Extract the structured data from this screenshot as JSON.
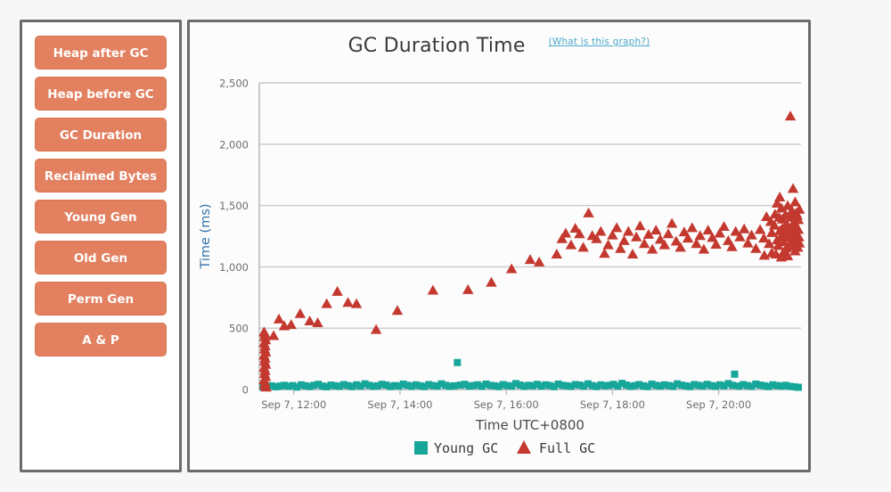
{
  "sidebar": {
    "items": [
      {
        "label": "Heap after GC"
      },
      {
        "label": "Heap before GC"
      },
      {
        "label": "GC Duration"
      },
      {
        "label": "Reclaimed Bytes"
      },
      {
        "label": "Young Gen"
      },
      {
        "label": "Old Gen"
      },
      {
        "label": "Perm Gen"
      },
      {
        "label": "A & P"
      }
    ]
  },
  "chart_panel": {
    "title": "GC Duration Time",
    "help_link": "(What is this graph?)"
  },
  "colors": {
    "button": "#e28060",
    "button_border": "#d9744f",
    "panel_border": "#6b6b6b",
    "young_gc": "#17a79a",
    "full_gc": "#c4392f",
    "grid": "#c9c9c9",
    "axis_title_y": "#2f6fa8",
    "link": "#4aa8c9"
  },
  "chart_data": {
    "type": "scatter",
    "title": "GC Duration Time",
    "xlabel": "Time UTC+0800",
    "ylabel": "Time (ms)",
    "ylim": [
      0,
      2500
    ],
    "yticks": [
      0,
      500,
      1000,
      1500,
      2000,
      2500
    ],
    "ytick_labels": [
      "0",
      "500",
      "1,000",
      "1,500",
      "2,000",
      "2,500"
    ],
    "xlim": [
      11.35,
      21.55
    ],
    "xticks": [
      12,
      14,
      16,
      18,
      20
    ],
    "xtick_labels": [
      "Sep 7, 12:00",
      "Sep 7, 14:00",
      "Sep 7, 16:00",
      "Sep 7, 18:00",
      "Sep 7, 20:00"
    ],
    "grid": true,
    "legend_position": "bottom",
    "series": [
      {
        "name": "Young GC",
        "marker": "square",
        "color": "#17a79a",
        "points": [
          [
            11.42,
            18
          ],
          [
            11.5,
            24
          ],
          [
            11.58,
            30
          ],
          [
            11.66,
            22
          ],
          [
            11.74,
            28
          ],
          [
            11.82,
            34
          ],
          [
            11.9,
            26
          ],
          [
            11.98,
            32
          ],
          [
            12.06,
            20
          ],
          [
            12.14,
            38
          ],
          [
            12.22,
            30
          ],
          [
            12.3,
            24
          ],
          [
            12.38,
            34
          ],
          [
            12.46,
            42
          ],
          [
            12.54,
            28
          ],
          [
            12.62,
            22
          ],
          [
            12.7,
            36
          ],
          [
            12.78,
            30
          ],
          [
            12.86,
            26
          ],
          [
            12.94,
            40
          ],
          [
            13.02,
            32
          ],
          [
            13.1,
            24
          ],
          [
            13.18,
            38
          ],
          [
            13.26,
            28
          ],
          [
            13.34,
            46
          ],
          [
            13.42,
            34
          ],
          [
            13.5,
            26
          ],
          [
            13.58,
            30
          ],
          [
            13.66,
            42
          ],
          [
            13.74,
            36
          ],
          [
            13.82,
            24
          ],
          [
            13.9,
            32
          ],
          [
            13.98,
            28
          ],
          [
            14.06,
            44
          ],
          [
            14.14,
            34
          ],
          [
            14.22,
            26
          ],
          [
            14.3,
            38
          ],
          [
            14.38,
            30
          ],
          [
            14.46,
            24
          ],
          [
            14.54,
            40
          ],
          [
            14.62,
            32
          ],
          [
            14.7,
            28
          ],
          [
            14.78,
            46
          ],
          [
            14.86,
            34
          ],
          [
            14.94,
            26
          ],
          [
            15.02,
            30
          ],
          [
            15.08,
            220
          ],
          [
            15.14,
            36
          ],
          [
            15.22,
            42
          ],
          [
            15.3,
            28
          ],
          [
            15.38,
            32
          ],
          [
            15.46,
            38
          ],
          [
            15.54,
            26
          ],
          [
            15.62,
            44
          ],
          [
            15.7,
            34
          ],
          [
            15.78,
            30
          ],
          [
            15.86,
            24
          ],
          [
            15.94,
            40
          ],
          [
            16.02,
            32
          ],
          [
            16.1,
            28
          ],
          [
            16.18,
            48
          ],
          [
            16.26,
            36
          ],
          [
            16.34,
            26
          ],
          [
            16.42,
            34
          ],
          [
            16.5,
            30
          ],
          [
            16.58,
            42
          ],
          [
            16.66,
            28
          ],
          [
            16.74,
            38
          ],
          [
            16.82,
            32
          ],
          [
            16.9,
            24
          ],
          [
            16.98,
            44
          ],
          [
            17.06,
            34
          ],
          [
            17.14,
            30
          ],
          [
            17.22,
            26
          ],
          [
            17.3,
            40
          ],
          [
            17.38,
            36
          ],
          [
            17.46,
            28
          ],
          [
            17.54,
            46
          ],
          [
            17.62,
            32
          ],
          [
            17.7,
            24
          ],
          [
            17.78,
            38
          ],
          [
            17.86,
            30
          ],
          [
            17.94,
            34
          ],
          [
            18.02,
            42
          ],
          [
            18.1,
            28
          ],
          [
            18.18,
            50
          ],
          [
            18.26,
            36
          ],
          [
            18.34,
            26
          ],
          [
            18.42,
            32
          ],
          [
            18.5,
            40
          ],
          [
            18.58,
            30
          ],
          [
            18.66,
            24
          ],
          [
            18.74,
            44
          ],
          [
            18.82,
            34
          ],
          [
            18.9,
            28
          ],
          [
            18.98,
            38
          ],
          [
            19.06,
            32
          ],
          [
            19.14,
            26
          ],
          [
            19.22,
            46
          ],
          [
            19.3,
            36
          ],
          [
            19.38,
            30
          ],
          [
            19.46,
            24
          ],
          [
            19.54,
            40
          ],
          [
            19.62,
            34
          ],
          [
            19.7,
            28
          ],
          [
            19.78,
            42
          ],
          [
            19.86,
            32
          ],
          [
            19.94,
            26
          ],
          [
            20.02,
            38
          ],
          [
            20.1,
            30
          ],
          [
            20.18,
            48
          ],
          [
            20.26,
            34
          ],
          [
            20.3,
            125
          ],
          [
            20.38,
            28
          ],
          [
            20.46,
            40
          ],
          [
            20.54,
            32
          ],
          [
            20.62,
            26
          ],
          [
            20.7,
            44
          ],
          [
            20.78,
            36
          ],
          [
            20.86,
            30
          ],
          [
            20.94,
            24
          ],
          [
            21.02,
            38
          ],
          [
            21.1,
            32
          ],
          [
            21.18,
            28
          ],
          [
            21.26,
            34
          ],
          [
            21.34,
            26
          ],
          [
            21.42,
            22
          ],
          [
            21.5,
            18
          ]
        ]
      },
      {
        "name": "Full GC",
        "marker": "triangle",
        "color": "#c4392f",
        "points": [
          [
            11.44,
            470
          ],
          [
            11.46,
            455
          ],
          [
            11.45,
            430
          ],
          [
            11.47,
            405
          ],
          [
            11.44,
            380
          ],
          [
            11.46,
            355
          ],
          [
            11.45,
            330
          ],
          [
            11.47,
            305
          ],
          [
            11.44,
            280
          ],
          [
            11.46,
            255
          ],
          [
            11.45,
            230
          ],
          [
            11.47,
            205
          ],
          [
            11.44,
            180
          ],
          [
            11.46,
            155
          ],
          [
            11.45,
            130
          ],
          [
            11.47,
            105
          ],
          [
            11.44,
            80
          ],
          [
            11.46,
            55
          ],
          [
            11.45,
            35
          ],
          [
            11.48,
            20
          ],
          [
            11.62,
            440
          ],
          [
            11.72,
            575
          ],
          [
            11.82,
            520
          ],
          [
            11.95,
            530
          ],
          [
            12.12,
            620
          ],
          [
            12.3,
            560
          ],
          [
            12.45,
            545
          ],
          [
            12.62,
            700
          ],
          [
            12.82,
            800
          ],
          [
            13.02,
            710
          ],
          [
            13.18,
            700
          ],
          [
            13.55,
            490
          ],
          [
            13.95,
            645
          ],
          [
            14.62,
            810
          ],
          [
            15.28,
            815
          ],
          [
            15.72,
            875
          ],
          [
            16.1,
            985
          ],
          [
            16.45,
            1060
          ],
          [
            16.62,
            1040
          ],
          [
            16.95,
            1105
          ],
          [
            17.05,
            1230
          ],
          [
            17.12,
            1275
          ],
          [
            17.22,
            1180
          ],
          [
            17.3,
            1315
          ],
          [
            17.38,
            1270
          ],
          [
            17.45,
            1160
          ],
          [
            17.55,
            1440
          ],
          [
            17.62,
            1255
          ],
          [
            17.7,
            1230
          ],
          [
            17.78,
            1290
          ],
          [
            17.85,
            1110
          ],
          [
            17.92,
            1180
          ],
          [
            18.0,
            1260
          ],
          [
            18.08,
            1320
          ],
          [
            18.15,
            1150
          ],
          [
            18.22,
            1215
          ],
          [
            18.3,
            1290
          ],
          [
            18.38,
            1105
          ],
          [
            18.45,
            1245
          ],
          [
            18.52,
            1335
          ],
          [
            18.6,
            1190
          ],
          [
            18.68,
            1265
          ],
          [
            18.75,
            1145
          ],
          [
            18.82,
            1300
          ],
          [
            18.9,
            1225
          ],
          [
            18.98,
            1180
          ],
          [
            19.05,
            1270
          ],
          [
            19.12,
            1355
          ],
          [
            19.2,
            1210
          ],
          [
            19.28,
            1160
          ],
          [
            19.35,
            1285
          ],
          [
            19.42,
            1235
          ],
          [
            19.5,
            1320
          ],
          [
            19.58,
            1190
          ],
          [
            19.65,
            1255
          ],
          [
            19.72,
            1145
          ],
          [
            19.8,
            1300
          ],
          [
            19.88,
            1240
          ],
          [
            19.95,
            1185
          ],
          [
            20.02,
            1275
          ],
          [
            20.1,
            1330
          ],
          [
            20.18,
            1215
          ],
          [
            20.25,
            1165
          ],
          [
            20.32,
            1290
          ],
          [
            20.4,
            1245
          ],
          [
            20.48,
            1310
          ],
          [
            20.55,
            1195
          ],
          [
            20.62,
            1260
          ],
          [
            20.7,
            1150
          ],
          [
            20.78,
            1305
          ],
          [
            20.85,
            1235
          ],
          [
            20.9,
            1410
          ],
          [
            20.95,
            1190
          ],
          [
            21.0,
            1280
          ],
          [
            21.05,
            1340
          ],
          [
            21.1,
            1220
          ],
          [
            21.12,
            1175
          ],
          [
            21.15,
            1295
          ],
          [
            21.18,
            1250
          ],
          [
            21.2,
            1315
          ],
          [
            21.22,
            1205
          ],
          [
            21.25,
            1265
          ],
          [
            21.28,
            1155
          ],
          [
            21.3,
            1300
          ],
          [
            21.32,
            1240
          ],
          [
            21.34,
            1190
          ],
          [
            21.36,
            1280
          ],
          [
            21.38,
            1335
          ],
          [
            21.4,
            1215
          ],
          [
            21.42,
            1170
          ],
          [
            21.44,
            1290
          ],
          [
            21.45,
            1250
          ],
          [
            21.46,
            1310
          ],
          [
            21.47,
            1200
          ],
          [
            21.48,
            1265
          ],
          [
            21.49,
            1160
          ],
          [
            21.5,
            1305
          ],
          [
            21.51,
            1245
          ],
          [
            21.52,
            1195
          ],
          [
            21.1,
            1520
          ],
          [
            21.18,
            1480
          ],
          [
            21.26,
            1425
          ],
          [
            21.3,
            1500
          ],
          [
            21.38,
            1460
          ],
          [
            21.44,
            1530
          ],
          [
            21.48,
            1420
          ],
          [
            21.52,
            1470
          ],
          [
            21.2,
            1390
          ],
          [
            21.28,
            1350
          ],
          [
            21.36,
            1405
          ],
          [
            21.42,
            1370
          ],
          [
            21.46,
            1440
          ],
          [
            21.5,
            1385
          ],
          [
            20.98,
            1370
          ],
          [
            21.06,
            1430
          ],
          [
            21.14,
            1405
          ],
          [
            21.4,
            1640
          ],
          [
            21.15,
            1570
          ],
          [
            21.35,
            2230
          ],
          [
            21.08,
            1105
          ],
          [
            21.22,
            1120
          ],
          [
            21.3,
            1090
          ],
          [
            21.44,
            1130
          ],
          [
            20.86,
            1095
          ],
          [
            21.0,
            1115
          ],
          [
            21.18,
            1080
          ]
        ]
      }
    ]
  }
}
